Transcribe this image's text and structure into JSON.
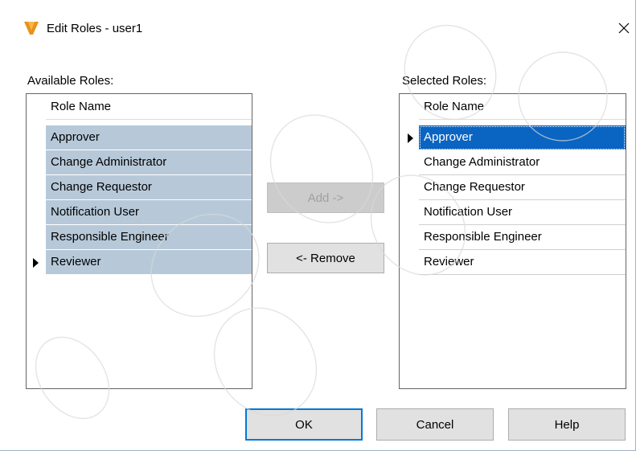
{
  "window": {
    "title": "Edit Roles - user1",
    "app_icon_letter": "V"
  },
  "available": {
    "label": "Available Roles:",
    "column_header": "Role Name",
    "rows": [
      "Approver",
      "Change Administrator",
      "Change Requestor",
      "Notification User",
      "Responsible Engineer",
      "Reviewer"
    ]
  },
  "selected": {
    "label": "Selected Roles:",
    "column_header": "Role Name",
    "rows": [
      "Approver",
      "Change Administrator",
      "Change Requestor",
      "Notification User",
      "Responsible Engineer",
      "Reviewer"
    ]
  },
  "buttons": {
    "add": "Add ->",
    "remove": "<- Remove",
    "ok": "OK",
    "cancel": "Cancel",
    "help": "Help"
  },
  "colors": {
    "selection_gray": "#b7c9d9",
    "focus_blue": "#0a64c2",
    "default_border": "#0078d7"
  }
}
